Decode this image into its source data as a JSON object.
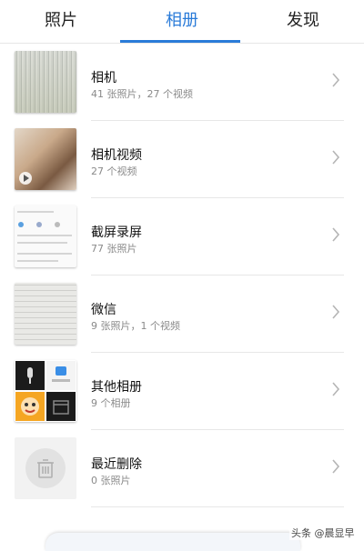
{
  "tabs": [
    {
      "label": "照片"
    },
    {
      "label": "相册"
    },
    {
      "label": "发现"
    }
  ],
  "active_tab_color": "#2a7bd8",
  "albums": [
    {
      "title": "相机",
      "subtitle": "41 张照片，27 个视频"
    },
    {
      "title": "相机视频",
      "subtitle": "27 个视频"
    },
    {
      "title": "截屏录屏",
      "subtitle": "77 张照片"
    },
    {
      "title": "微信",
      "subtitle": "9 张照片，1 个视频"
    },
    {
      "title": "其他相册",
      "subtitle": "9 个相册"
    },
    {
      "title": "最近删除",
      "subtitle": "0 张照片"
    }
  ],
  "watermark": "头条 @晨显早"
}
